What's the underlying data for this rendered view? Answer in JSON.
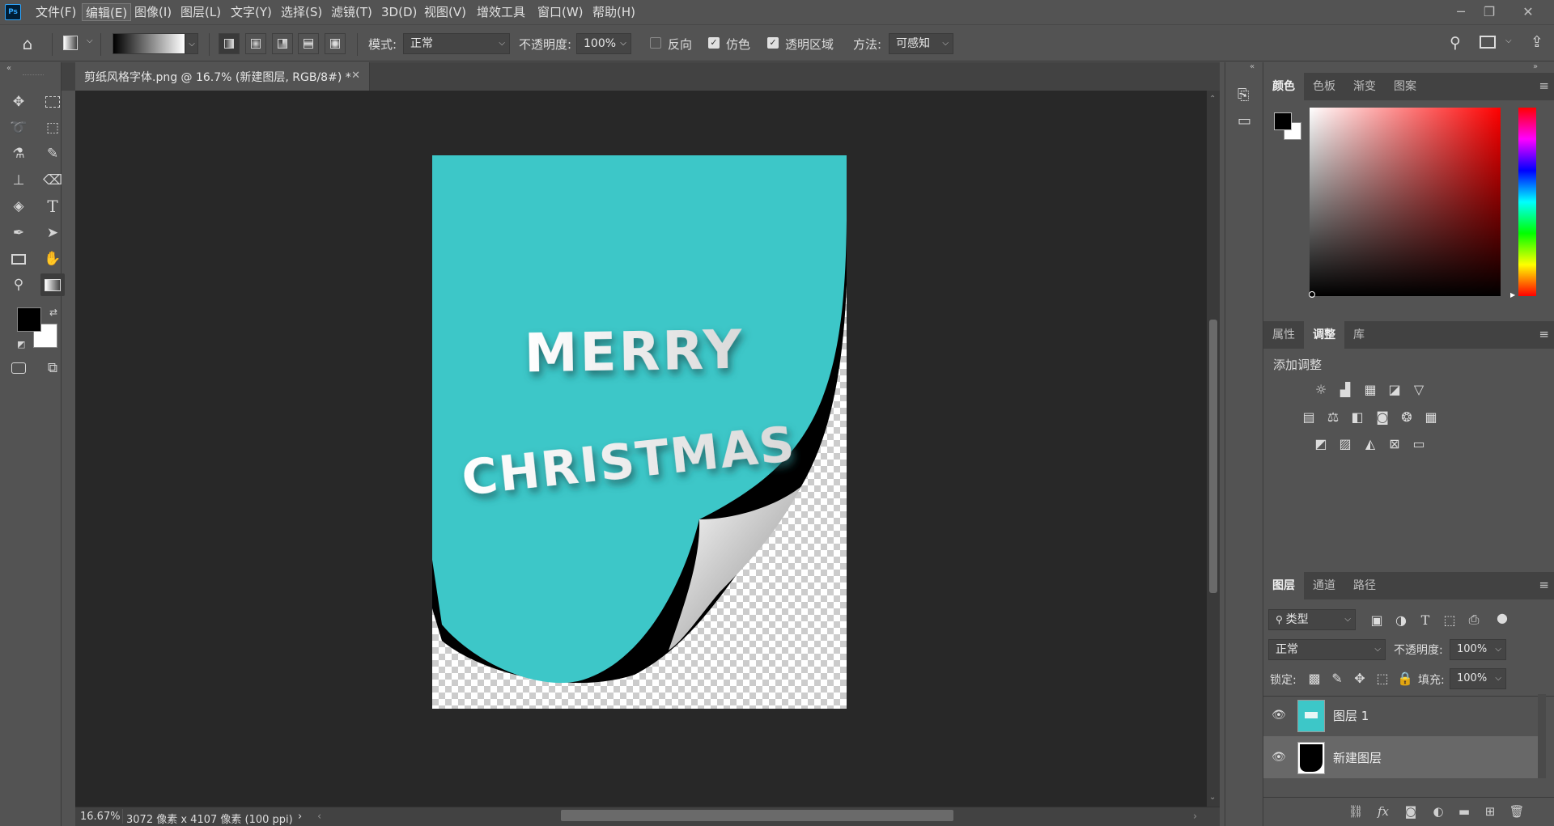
{
  "app": {
    "logo": "Ps",
    "menu": [
      "文件(F)",
      "编辑(E)",
      "图像(I)",
      "图层(L)",
      "文字(Y)",
      "选择(S)",
      "滤镜(T)",
      "3D(D)",
      "视图(V)",
      "增效工具",
      "窗口(W)",
      "帮助(H)"
    ],
    "active_menu_index": 1
  },
  "options_bar": {
    "mode_label": "模式:",
    "mode_value": "正常",
    "opacity_label": "不透明度:",
    "opacity_value": "100%",
    "reverse_label": "反向",
    "reverse_checked": false,
    "dither_label": "仿色",
    "dither_checked": true,
    "transparency_label": "透明区域",
    "transparency_checked": true,
    "method_label": "方法:",
    "method_value": "可感知"
  },
  "document": {
    "tab_title": "剪纸风格字体.png @ 16.7% (新建图层, RGB/8#) *",
    "zoom": "16.67%",
    "size_info": "3072 像素 x 4107 像素 (100 ppi)",
    "art_line1": "MERRY",
    "art_line2": "CHRISTMAS",
    "art_color": "#3dc7c8"
  },
  "panels": {
    "color_tabs": [
      "颜色",
      "色板",
      "渐变",
      "图案"
    ],
    "adjust_tabs": [
      "属性",
      "调整",
      "库"
    ],
    "adjust_title": "添加调整",
    "layers_tabs": [
      "图层",
      "通道",
      "路径"
    ],
    "filter_kind": "类型",
    "blend_mode": "正常",
    "opacity_label": "不透明度:",
    "opacity_value": "100%",
    "lock_label": "锁定:",
    "fill_label": "填充:",
    "fill_value": "100%",
    "layers": [
      {
        "name": "图层 1",
        "selected": false
      },
      {
        "name": "新建图层",
        "selected": true
      }
    ]
  }
}
